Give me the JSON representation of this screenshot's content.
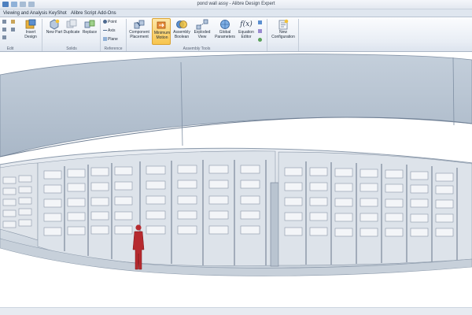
{
  "window": {
    "title": "pond wall assy - Alibre Design Expert"
  },
  "menu_tabs": [
    "Viewing and Analysis",
    "KeyShot",
    "Alibre Script",
    "Add-Ons"
  ],
  "ribbon": {
    "groups": {
      "edit": "Edit",
      "solids": "Solids",
      "reference": "Reference",
      "assembly_tools": "Assembly Tools"
    },
    "buttons": {
      "insert_design": "Insert Design",
      "new_part": "New Part",
      "duplicate": "Duplicate",
      "replace": "Replace",
      "point": "Point",
      "axis": "Axis",
      "plane": "Plane",
      "component_placement": "Component Placement",
      "minimum_motion": "Minimum Motion",
      "assembly_boolean": "Assembly Boolean",
      "exploded_view": "Exploded View",
      "global_parameters": "Global Parameters",
      "equation_editor": "Equation Editor",
      "equation_symbol": "f(x)",
      "new_configuration": "New Configuration"
    }
  },
  "colors": {
    "wall_top": "#cfd8e2",
    "wall_face": "#c2ccd8",
    "panel_light": "#eef1f4",
    "figure": "#b62a2f",
    "ribbon_active": "#f7c44c"
  },
  "icons": [
    "insert-design-icon",
    "new-part-icon",
    "duplicate-icon",
    "replace-icon",
    "point-icon",
    "axis-icon",
    "plane-icon",
    "component-placement-icon",
    "minimum-motion-icon",
    "assembly-boolean-icon",
    "exploded-view-icon",
    "global-parameters-icon",
    "equation-editor-icon",
    "new-configuration-icon"
  ]
}
